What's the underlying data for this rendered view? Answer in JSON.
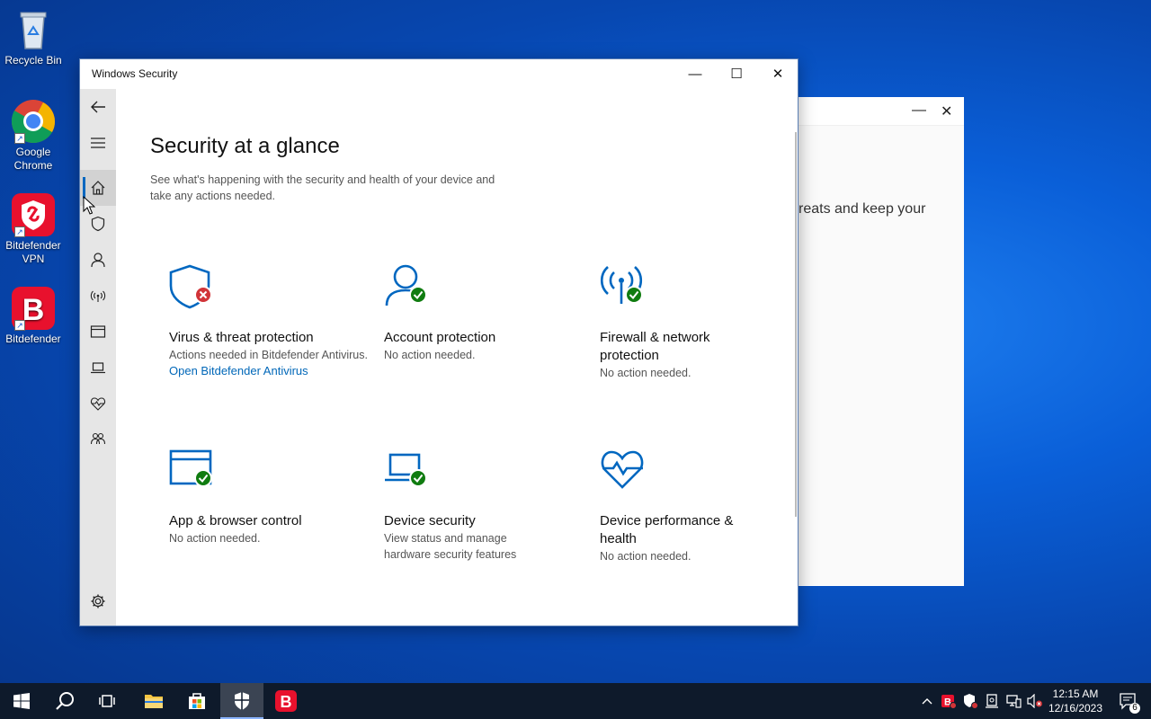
{
  "desktop": {
    "icons": [
      {
        "label": "Recycle Bin"
      },
      {
        "label": "Google Chrome"
      },
      {
        "label": "Bitdefender VPN"
      },
      {
        "label": "Bitdefender"
      }
    ]
  },
  "background_window": {
    "partial_text": "reats and keep your",
    "minimize_glyph": "—",
    "close_glyph": "✕"
  },
  "window": {
    "title": "Windows Security",
    "minimize_glyph": "—",
    "maximize_glyph": "☐",
    "close_glyph": "✕"
  },
  "sidebar": {
    "items": [
      {
        "icon": "back-arrow-icon"
      },
      {
        "icon": "hamburger-menu-icon"
      },
      {
        "icon": "home-icon",
        "active": true
      },
      {
        "icon": "shield-icon"
      },
      {
        "icon": "person-icon"
      },
      {
        "icon": "wifi-antenna-icon"
      },
      {
        "icon": "browser-window-icon"
      },
      {
        "icon": "laptop-icon"
      },
      {
        "icon": "heart-pulse-icon"
      },
      {
        "icon": "family-icon"
      },
      {
        "icon": "gear-icon"
      }
    ]
  },
  "main": {
    "heading": "Security at a glance",
    "subtitle": "See what's happening with the security and health of your device and take any actions needed.",
    "cards": [
      {
        "title": "Virus & threat protection",
        "desc": "Actions needed in Bitdefender Antivirus.",
        "link": "Open Bitdefender Antivirus",
        "icon": "shield-icon",
        "status": "error"
      },
      {
        "title": "Account protection",
        "desc": "No action needed.",
        "icon": "person-icon",
        "status": "ok"
      },
      {
        "title": "Firewall & network protection",
        "desc": "No action needed.",
        "icon": "wifi-antenna-icon",
        "status": "ok"
      },
      {
        "title": "App & browser control",
        "desc": "No action needed.",
        "icon": "browser-window-icon",
        "status": "ok"
      },
      {
        "title": "Device security",
        "desc": "View status and manage hardware security features",
        "icon": "laptop-icon",
        "status": "ok"
      },
      {
        "title": "Device performance & health",
        "desc": "No action needed.",
        "icon": "heart-pulse-icon",
        "status": "none"
      }
    ]
  },
  "taskbar": {
    "clock_time": "12:15 AM",
    "clock_date": "12/16/2023",
    "notification_count": "6"
  },
  "colors": {
    "accent_blue": "#0067c0",
    "ok_green": "#107c10",
    "error_red": "#d13438",
    "bitdefender_red": "#e8112d"
  }
}
